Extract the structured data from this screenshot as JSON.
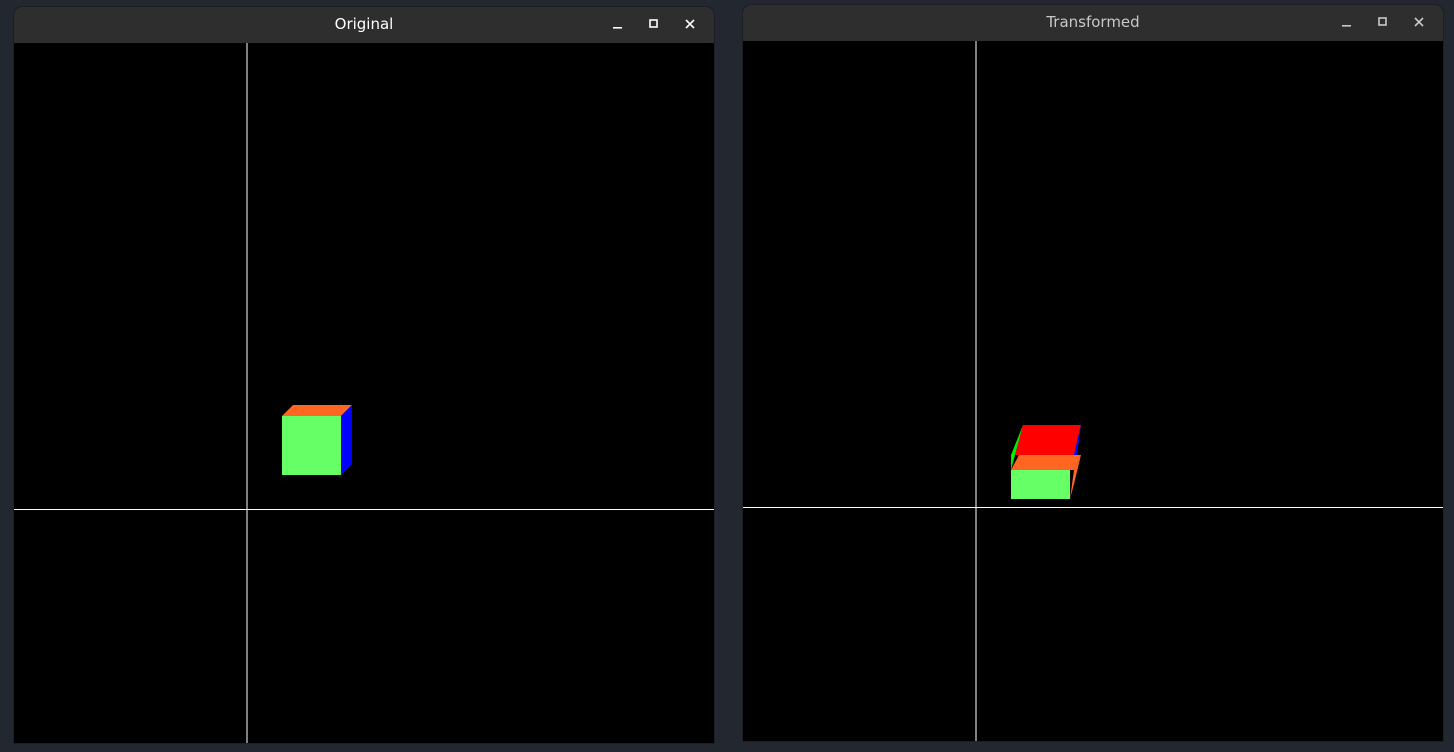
{
  "windows": [
    {
      "title": "Original",
      "controls": [
        "minimize-icon",
        "maximize-icon",
        "close-icon"
      ]
    },
    {
      "title": "Transformed",
      "controls": [
        "minimize-icon",
        "maximize-icon",
        "close-icon"
      ]
    }
  ],
  "colors": {
    "desktop": "#222730",
    "titlebar": "#2e2e2e",
    "viewport_bg": "#000000",
    "axes": "#ffffff",
    "face_front": "#66ff66",
    "face_top": "#ff6622",
    "face_side": "#0000ff",
    "face_back": "#ff0000",
    "face_left": "#00ee00"
  }
}
